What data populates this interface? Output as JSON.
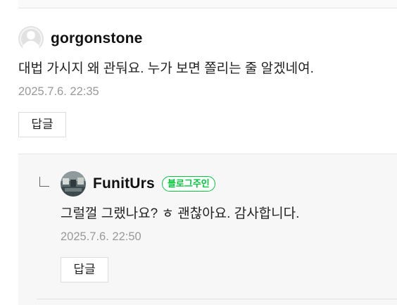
{
  "comment": {
    "author": "gorgonstone",
    "text": "대법 가시지 왜 관둬요. 누가 보면 쫄리는 줄 알겠네여.",
    "date": "2025.7.6. 22:35",
    "reply_label": "답글",
    "avatar_icon": "default-profile-icon"
  },
  "reply": {
    "author": "FunitUrs",
    "badge": "블로그주인",
    "text": "그럴껄 그랬나요? ㅎ 괜찮아요. 감사합니다.",
    "date": "2025.7.6. 22:50",
    "reply_label": "답글",
    "marker_icon": "reply-arrow-icon"
  },
  "colors": {
    "badge": "#00c73c",
    "reply_bg": "#f7f7f7",
    "date": "#999999"
  }
}
